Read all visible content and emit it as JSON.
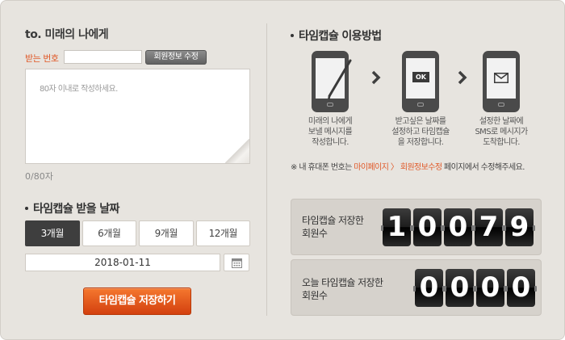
{
  "letter": {
    "title": "to. 미래의 나에게",
    "phone_label": "받는 번호",
    "phone_value": "",
    "info_button": "회원정보 수정",
    "message_placeholder": "80자 이내로 작성하세요.",
    "char_counter": "0/80자"
  },
  "receive_date": {
    "title": "타임캡슐 받을 날짜",
    "tabs": [
      {
        "label": "3개월",
        "active": true
      },
      {
        "label": "6개월",
        "active": false
      },
      {
        "label": "9개월",
        "active": false
      },
      {
        "label": "12개월",
        "active": false
      }
    ],
    "date_value": "2018-01-11",
    "calendar_icon": "calendar-icon"
  },
  "save_button": "타임캡슐 저장하기",
  "usage": {
    "title": "타임캡슐 이용방법",
    "steps": [
      {
        "icon": "pen-phone-icon",
        "line1": "미래의 나에게",
        "line2": "보낼 메시지를",
        "line3": "작성합니다."
      },
      {
        "icon": "ok-phone-icon",
        "ok_text": "OK",
        "line1": "받고싶은 날짜를",
        "line2": "설정하고 타임캡슐",
        "line3": "을 저장합니다."
      },
      {
        "icon": "envelope-phone-icon",
        "line1": "설정한 날짜에",
        "line2": "SMS로 메시지가",
        "line3": "도착합니다."
      }
    ],
    "note_prefix": "※ 내 휴대폰 번호는 ",
    "note_highlight": "마이페이지 〉 회원정보수정",
    "note_suffix": " 페이지에서 수정해주세요."
  },
  "stats": {
    "total": {
      "line1": "타임캡슐 저장한",
      "line2": "회원수",
      "digits": [
        "1",
        "0",
        "0",
        "7",
        "9"
      ]
    },
    "today": {
      "line1": "오늘 타임캡슐 저장한",
      "line2": "회원수",
      "digits": [
        "0",
        "0",
        "0",
        "0"
      ]
    }
  },
  "colors": {
    "accent_orange": "#e05a2a",
    "save_button": "#e8581f",
    "active_tab": "#3e3e3e",
    "panel_bg": "#e7e4df"
  }
}
